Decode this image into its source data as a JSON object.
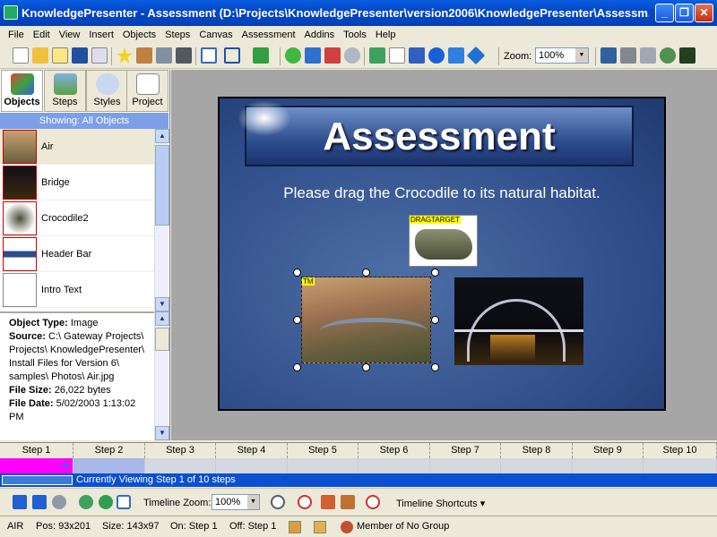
{
  "window": {
    "title": "KnowledgePresenter - Assessment (D:\\Projects\\KnowledgePresenter\\version2006\\KnowledgePresenter\\Assessm..."
  },
  "menu": [
    "File",
    "Edit",
    "View",
    "Insert",
    "Objects",
    "Steps",
    "Canvas",
    "Assessment",
    "Addins",
    "Tools",
    "Help"
  ],
  "toolbar": {
    "zoom_label": "Zoom:",
    "zoom_value": "100%"
  },
  "left_tabs": [
    "Objects",
    "Steps",
    "Styles",
    "Project"
  ],
  "showing": "Showing: All Objects",
  "objects": [
    "Air",
    "Bridge",
    "Crocodile2",
    "Header Bar",
    "Intro Text"
  ],
  "props": {
    "type_label": "Object Type:",
    "type_value": "Image",
    "source_label": "Source:",
    "source_value": "C:\\ Gateway Projects\\ Projects\\ KnowledgePresenter\\ Install Files for Version 6\\ samples\\ Photos\\ Air.jpg",
    "size_label": "File Size:",
    "size_value": "26,022 bytes",
    "date_label": "File Date:",
    "date_value": "5/02/2003 1:13:02 PM"
  },
  "slide": {
    "title": "Assessment",
    "instruction": "Please drag the Crocodile to its natural habitat.",
    "drag_label": "DRAGTARGET",
    "tm_label": "TM"
  },
  "steps": [
    "Step 1",
    "Step 2",
    "Step 3",
    "Step 4",
    "Step 5",
    "Step 6",
    "Step 7",
    "Step 8",
    "Step 9",
    "Step 10"
  ],
  "viewing": "Currently Viewing Step 1 of 10 steps",
  "bottom": {
    "timeline_zoom_label": "Timeline Zoom:",
    "timeline_zoom_value": "100%",
    "shortcuts": "Timeline Shortcuts"
  },
  "status": {
    "name": "AIR",
    "pos": "Pos: 93x201",
    "size": "Size: 143x97",
    "on": "On: Step 1",
    "off": "Off: Step 1",
    "group": "Member of No Group"
  }
}
